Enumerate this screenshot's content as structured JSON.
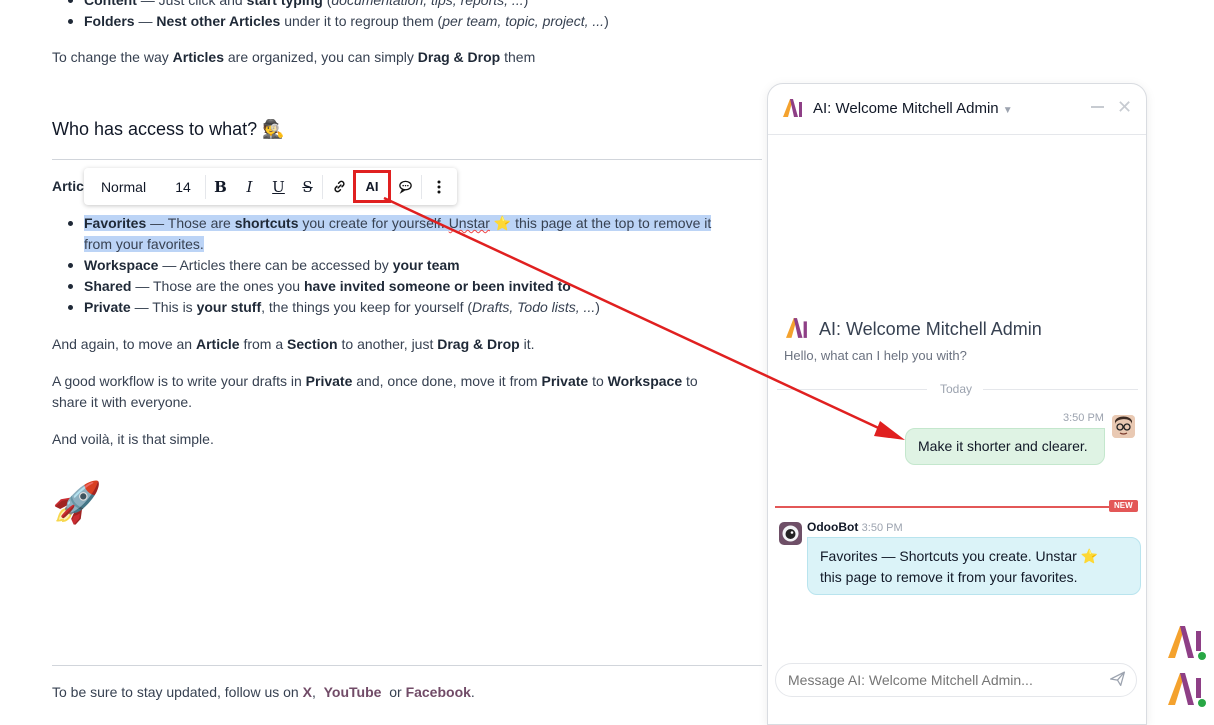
{
  "doc": {
    "top_items": [
      {
        "b": "Content",
        "t": " — Just click and ",
        "b2": "start typing",
        "t2": " (",
        "i": "documentation, tips, reports, ...",
        "t3": ")"
      },
      {
        "b": "Folders",
        "t": " — ",
        "b2": "Nest other Articles",
        "t2": " under it to regroup them (",
        "i": "per team, topic, project, ...",
        "t3": ")"
      }
    ],
    "organize": {
      "a": "To change the way ",
      "b": "Articles",
      "c": " are organized, you can simply ",
      "d": "Drag & Drop",
      "e": " them"
    },
    "heading": "Who has access to what?",
    "heading_emoji": "🕵️",
    "partial_para": "Artic",
    "list": [
      {
        "label": "Favorites",
        "a": " — Those are ",
        "b": "shortcuts",
        "c": " you create for yourself. ",
        "d": "Unstar",
        "star": "⭐",
        "e": " this page at the top to remove it",
        "f": "from your favorites."
      },
      {
        "label": "Workspace",
        "a": " — Articles there can be accessed by ",
        "b": "your team"
      },
      {
        "label": "Shared",
        "a": " — Those are the ones you ",
        "b": "have invited someone or been invited to"
      },
      {
        "label": "Private",
        "a": " — This is ",
        "b": "your stuff",
        "c": ", the things you keep for yourself (",
        "i": "Drafts, Todo lists, ...",
        "d": ")"
      }
    ],
    "move": {
      "a": "And again, to move an ",
      "b": "Article",
      "c": " from a ",
      "d": "Section",
      "e": " to another, just ",
      "f": "Drag & Drop",
      "g": " it."
    },
    "workflow": {
      "a": "A good workflow is to write your drafts in ",
      "b": "Private",
      "c": " and, once done, move it from ",
      "d": "Private",
      "e": " to ",
      "f": "Workspace",
      "g": " to",
      "h": "share it with everyone."
    },
    "voila": "And voilà, it is that simple.",
    "rocket": "🚀",
    "footer": {
      "a": "To be sure to stay updated, follow us on ",
      "x": "X",
      "comma": ",",
      "youtube": "YouTube",
      "or": "or",
      "facebook": "Facebook",
      "dot": "."
    }
  },
  "toolbar": {
    "style": "Normal",
    "size": "14",
    "bold": "B",
    "italic": "I",
    "underline": "U",
    "strike": "S",
    "ai": "AI",
    "link_icon": "link-icon",
    "comment_icon": "comment-icon",
    "more_icon": "more-icon"
  },
  "chat": {
    "title": "AI: Welcome Mitchell Admin",
    "welcome_title": "AI: Welcome Mitchell Admin",
    "welcome_sub": "Hello, what can I help you with?",
    "today": "Today",
    "user_time": "3:50 PM",
    "user_message": "Make it shorter and clearer.",
    "new_badge": "NEW",
    "bot_name": "OdooBot",
    "bot_time": "3:50 PM",
    "bot_message_a": "Favorites — Shortcuts you create. Unstar",
    "bot_star": "⭐",
    "bot_message_b": "this page to remove it from your favorites.",
    "placeholder": "Message AI: Welcome Mitchell Admin..."
  },
  "colors": {
    "accent": "#714b67",
    "highlight_box": "#e02020",
    "user_bubble": "#dff3e4",
    "bot_bubble": "#dbf3f8",
    "new_line": "#e35757"
  }
}
